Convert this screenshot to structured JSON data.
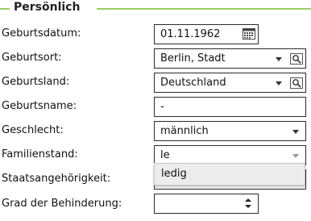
{
  "section": {
    "title": "Persönlich"
  },
  "fields": {
    "birthdate": {
      "label": "Geburtsdatum:",
      "value": "01.11.1962",
      "icon": "calendar-icon"
    },
    "birthplace": {
      "label": "Geburtsort:",
      "value": "Berlin, Stadt",
      "icons": [
        "chevron-down-icon",
        "search-icon"
      ]
    },
    "birthcountry": {
      "label": "Geburtsland:",
      "value": "Deutschland",
      "icons": [
        "chevron-down-icon",
        "search-icon"
      ]
    },
    "birthname": {
      "label": "Geburtsname:",
      "value": "-"
    },
    "gender": {
      "label": "Geschlecht:",
      "value": "männlich",
      "icon": "chevron-down-icon"
    },
    "marital": {
      "label": "Familienstand:",
      "value": "le",
      "icon": "chevron-down-icon",
      "options": [
        "ledig"
      ]
    },
    "nationality": {
      "label": "Staatsangehörigkeit:",
      "value": ""
    },
    "disability": {
      "label": "Grad der Behinderung:",
      "value": "",
      "icon": "stepper-icon"
    }
  },
  "colors": {
    "accent": "#9ccc65",
    "border": "#2b2b2b",
    "dropdown_bg": "#ececec"
  }
}
